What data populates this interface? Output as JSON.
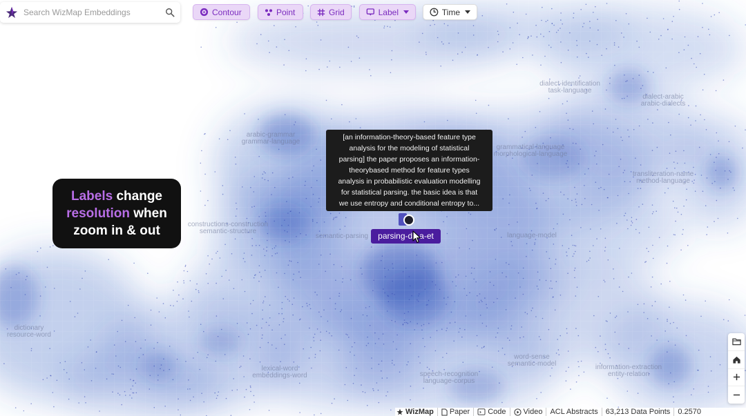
{
  "search": {
    "placeholder": "Search WizMap Embeddings"
  },
  "toolbar": {
    "contour": "Contour",
    "point": "Point",
    "grid": "Grid",
    "label": "Label",
    "time": "Time"
  },
  "callout": {
    "w1": "Labels",
    "w2": "change",
    "w3": "resolution",
    "w4": "when",
    "w5": "zoom in & out"
  },
  "tooltip": {
    "lines": [
      "[an information-theory-based feature type",
      "analysis for the modeling of statistical",
      "parsing] the paper proposes an information-",
      "theorybased method for feature types",
      "analysis in probabilistic evaluation modelling",
      "for statistical parsing. the basic idea is that",
      "we use entropy and conditional entropy to..."
    ]
  },
  "selected_label": "parsing-de   a-et",
  "map_labels": [
    "dialect-identification",
    "task-language",
    "dialect-arabic",
    "arabic-dialects",
    "arabic-grammar",
    "grammar-language",
    "grammatical-language",
    "morphological-language",
    "transliteration-name",
    "method-language",
    "constructions-construction",
    "semantic-structure",
    "semantic-parsing",
    "language-model",
    "dictionary",
    "resource-word",
    "lexical-word",
    "embeddings-word",
    "word-sense",
    "semantic-model",
    "speech-recognition",
    "language-corpus",
    "information-extraction",
    "entity-relation"
  ],
  "footer": {
    "brand": "WizMap",
    "paper": "Paper",
    "code": "Code",
    "video": "Video",
    "dataset": "ACL Abstracts",
    "points": "63,213 Data Points",
    "zoom": "0.2570"
  },
  "colors": {
    "density": "#3d62c4",
    "accent": "#7b2cbf",
    "label_bg": "#4a1d9e",
    "callout_highlight": "#b86ee6"
  }
}
